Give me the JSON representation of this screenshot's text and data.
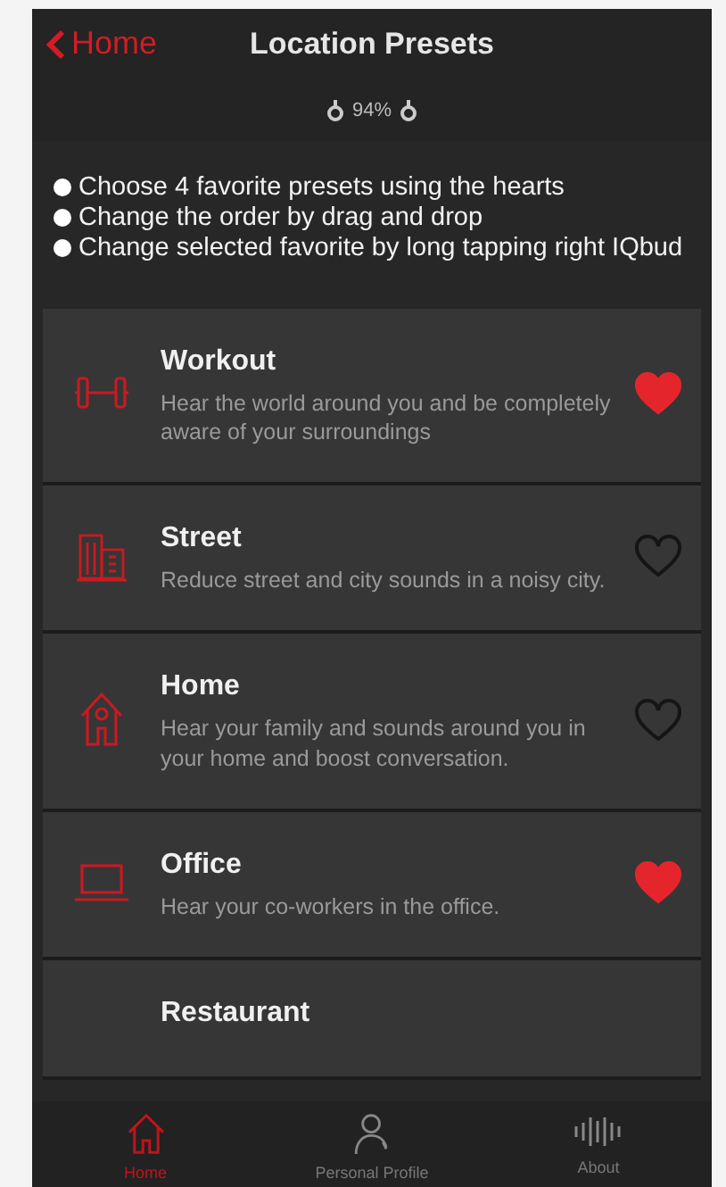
{
  "nav": {
    "back": "Home",
    "title": "Location Presets",
    "battery": "94%"
  },
  "tips": [
    "Choose 4 favorite presets using the hearts",
    "Change the order by drag and drop",
    "Change selected favorite by long tapping right IQbud"
  ],
  "presets": [
    {
      "kind": "dumbbell",
      "name": "Workout",
      "description": "Hear the world around you and be completely aware of your surroundings",
      "favorite": true
    },
    {
      "kind": "building",
      "name": "Street",
      "description": "Reduce street and city sounds in a noisy city.",
      "favorite": false
    },
    {
      "kind": "house",
      "name": "Home",
      "description": "Hear your family and sounds around you in your home and boost conversation.",
      "favorite": false
    },
    {
      "kind": "laptop",
      "name": "Office",
      "description": "Hear your co-workers in the office.",
      "favorite": true
    },
    {
      "kind": "none",
      "name": "Restaurant"
    }
  ],
  "tabs": [
    {
      "kind": "house",
      "label": "Home",
      "selected": true
    },
    {
      "kind": "person",
      "label": "Personal Profile",
      "selected": false
    },
    {
      "kind": "waves",
      "label": "About",
      "selected": false
    }
  ]
}
